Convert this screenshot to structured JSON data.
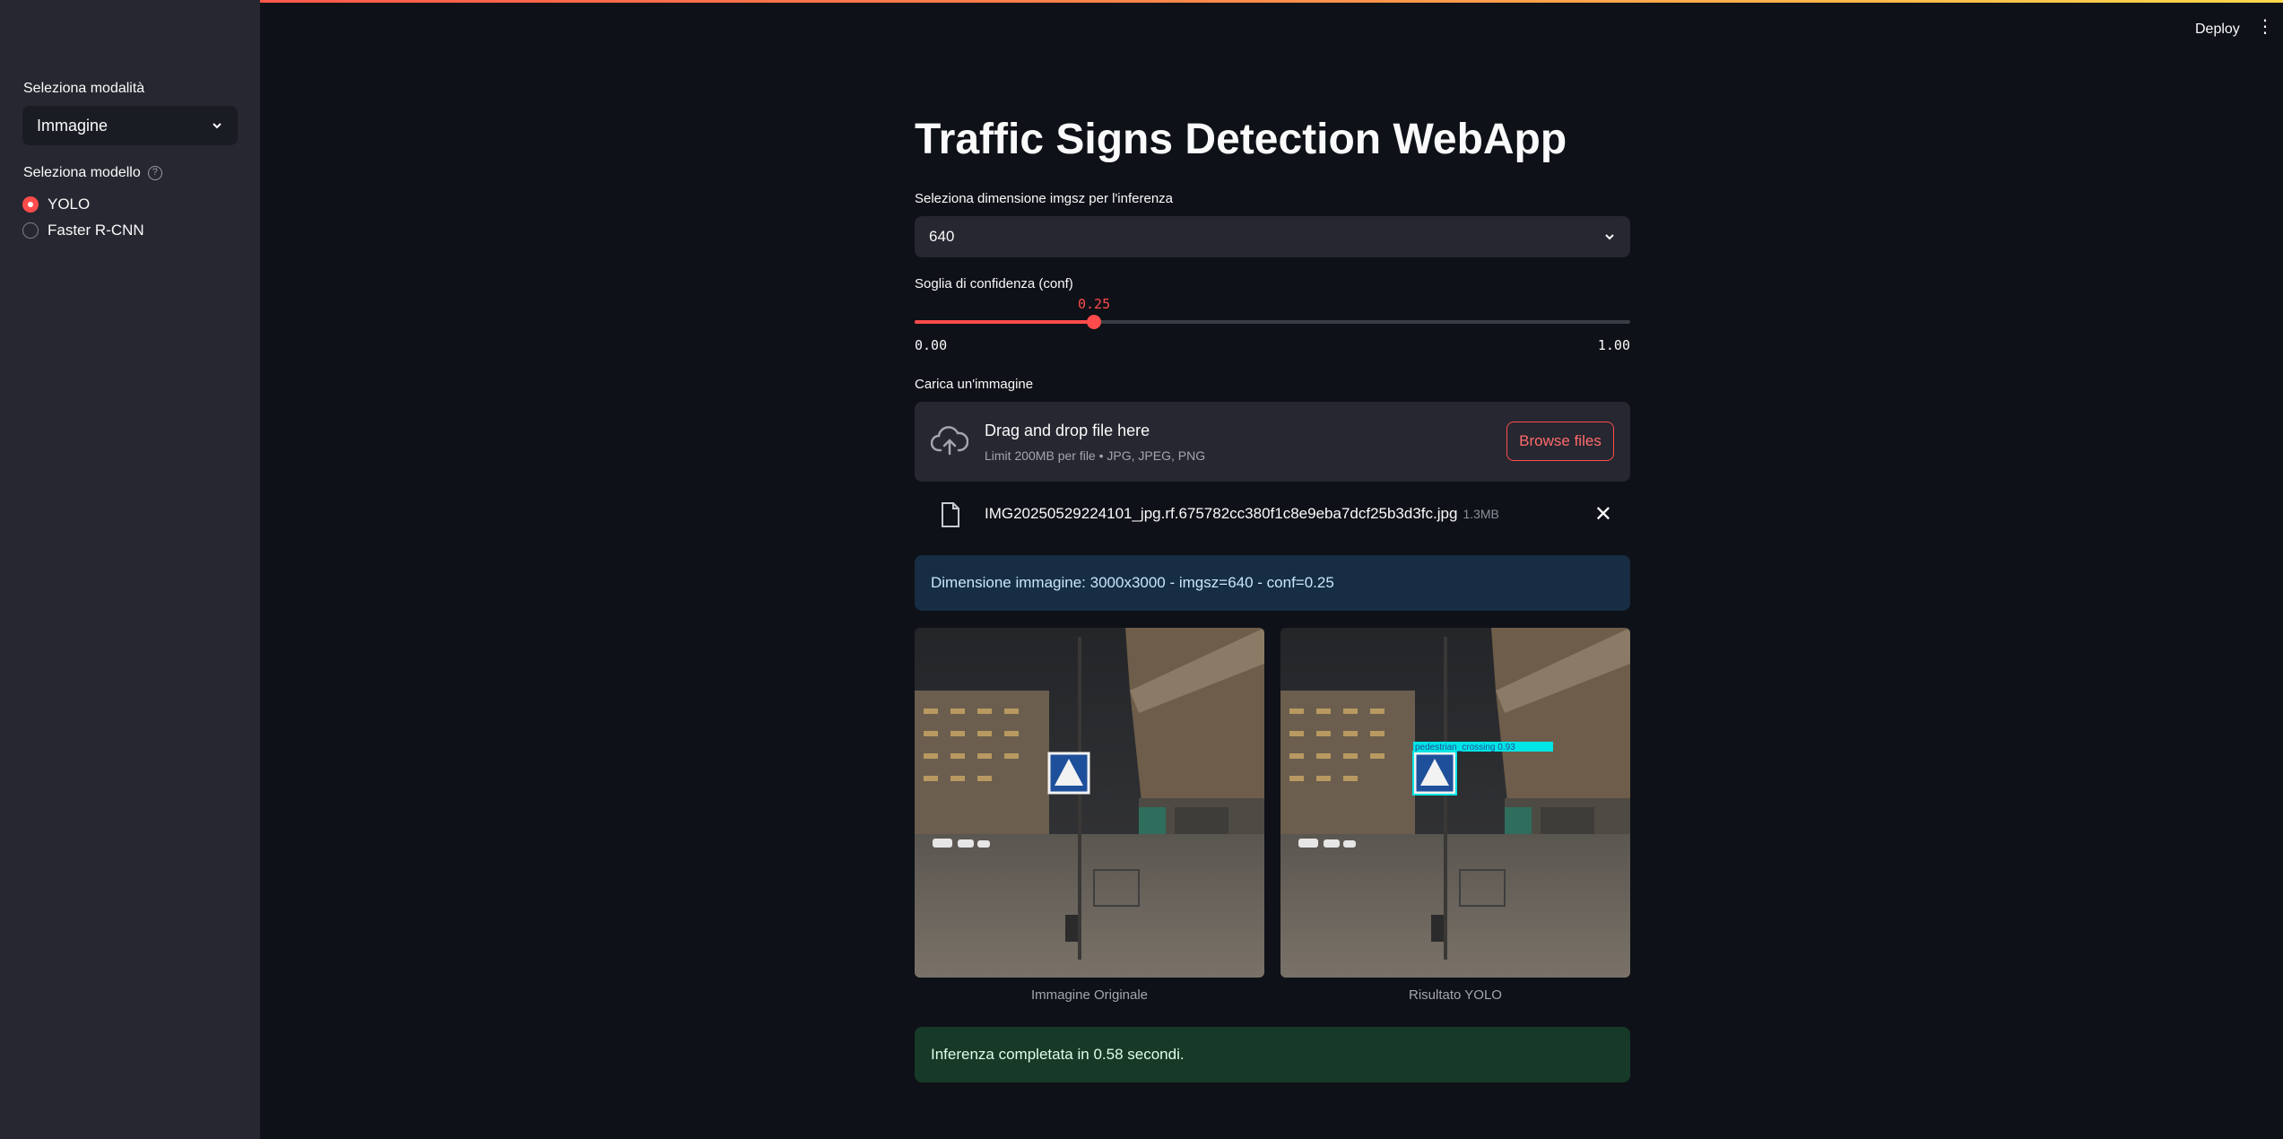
{
  "header": {
    "deploy_label": "Deploy",
    "menu_icon": "kebab-menu-icon"
  },
  "sidebar": {
    "mode_label": "Seleziona modalità",
    "mode_value": "Immagine",
    "model_label": "Seleziona modello",
    "model_help": "?",
    "models": [
      {
        "label": "YOLO",
        "selected": true
      },
      {
        "label": "Faster R-CNN",
        "selected": false
      }
    ]
  },
  "main": {
    "title": "Traffic Signs Detection WebApp",
    "imgsz_label": "Seleziona dimensione imgsz per l'inferenza",
    "imgsz_value": "640",
    "conf_label": "Soglia di confidenza (conf)",
    "conf_value": "0.25",
    "conf_fraction": 0.25,
    "conf_min": "0.00",
    "conf_max": "1.00",
    "upload_label": "Carica un'immagine",
    "dropzone_text": "Drag and drop file here",
    "dropzone_limit": "Limit 200MB per file • JPG, JPEG, PNG",
    "browse_label": "Browse files",
    "file_name": "IMG20250529224101_jpg.rf.675782cc380f1c8e9eba7dcf25b3d3fc.jpg",
    "file_size": "1.3MB",
    "info_text": "Dimensione immagine: 3000x3000 - imgsz=640 - conf=0.25",
    "caption_original": "Immagine Originale",
    "caption_result": "Risultato YOLO",
    "detection_label": "pedestrian_crossing 0.93",
    "success_text": "Inferenza completata in 0.58 secondi."
  },
  "colors": {
    "accent": "#ff4b4b",
    "bg": "#0e1117",
    "sidebar": "#262730",
    "detection": "#00e5e5"
  }
}
